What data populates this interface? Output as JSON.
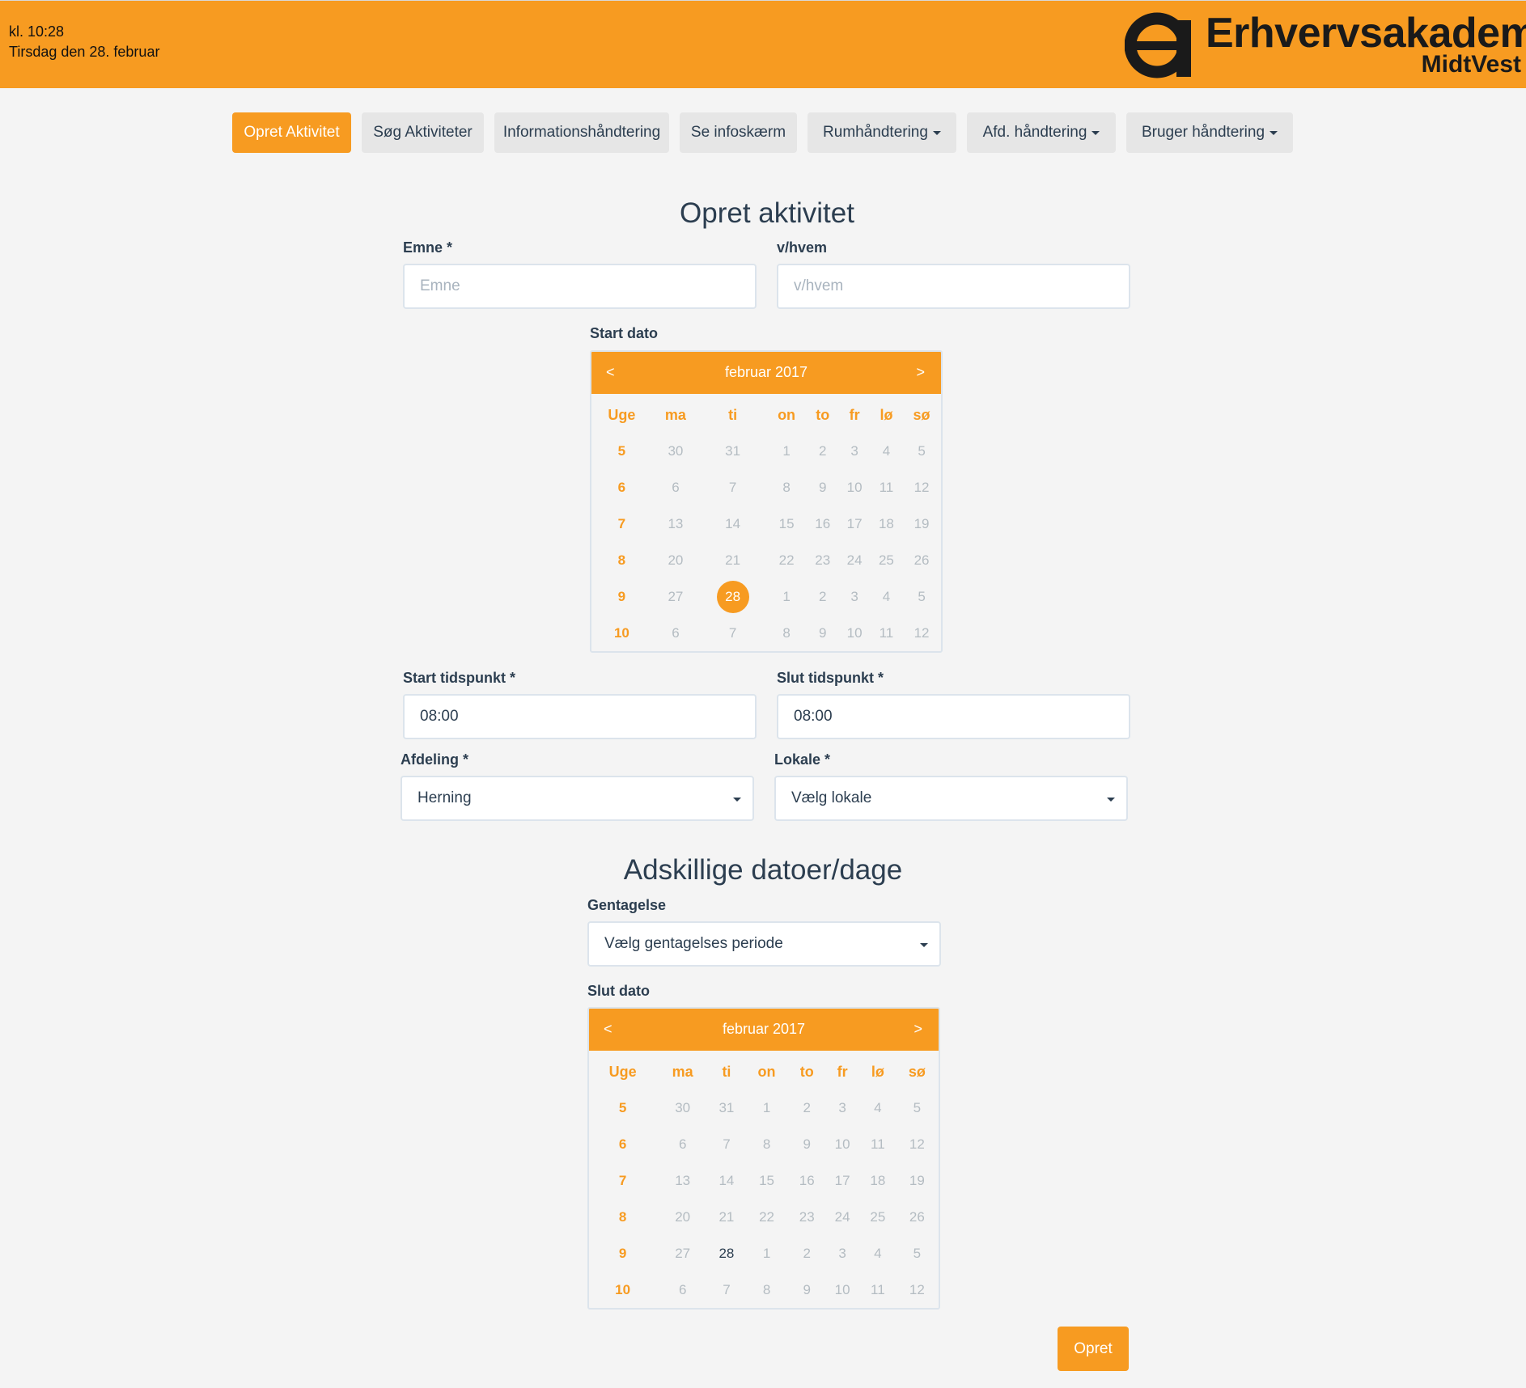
{
  "header": {
    "time": "kl. 10:28",
    "date": "Tirsdag den 28. februar",
    "logo_name": "Erhvervsakademi",
    "logo_sub": "MidtVest"
  },
  "nav": {
    "items": [
      {
        "label": "Opret Aktivitet",
        "active": true
      },
      {
        "label": "Søg Aktiviteter"
      },
      {
        "label": "Informationshåndtering"
      },
      {
        "label": "Se infoskærm"
      },
      {
        "label": "Rumhåndtering",
        "dropdown": true
      },
      {
        "label": "Afd. håndtering",
        "dropdown": true
      },
      {
        "label": "Bruger håndtering",
        "dropdown": true
      }
    ]
  },
  "form": {
    "title": "Opret aktivitet",
    "emne_label": "Emne *",
    "emne_placeholder": "Emne",
    "vhvem_label": "v/hvem",
    "vhvem_placeholder": "v/hvem",
    "start_dato_label": "Start dato",
    "start_tid_label": "Start tidspunkt *",
    "start_tid_value": "08:00",
    "slut_tid_label": "Slut tidspunkt *",
    "slut_tid_value": "08:00",
    "afdeling_label": "Afdeling *",
    "afdeling_value": "Herning",
    "lokale_label": "Lokale *",
    "lokale_value": "Vælg lokale"
  },
  "repeat": {
    "title": "Adskillige datoer/dage",
    "gentagelse_label": "Gentagelse",
    "gentagelse_value": "Vælg gentagelses periode",
    "slut_dato_label": "Slut dato"
  },
  "calendar": {
    "prev": "<",
    "next": ">",
    "month": "februar 2017",
    "headers": [
      "Uge",
      "ma",
      "ti",
      "on",
      "to",
      "fr",
      "lø",
      "sø"
    ],
    "weeks": [
      {
        "wk": "5",
        "days": [
          "30",
          "31",
          "1",
          "2",
          "3",
          "4",
          "5"
        ]
      },
      {
        "wk": "6",
        "days": [
          "6",
          "7",
          "8",
          "9",
          "10",
          "11",
          "12"
        ]
      },
      {
        "wk": "7",
        "days": [
          "13",
          "14",
          "15",
          "16",
          "17",
          "18",
          "19"
        ]
      },
      {
        "wk": "8",
        "days": [
          "20",
          "21",
          "22",
          "23",
          "24",
          "25",
          "26"
        ]
      },
      {
        "wk": "9",
        "days": [
          "27",
          "28",
          "1",
          "2",
          "3",
          "4",
          "5"
        ]
      },
      {
        "wk": "10",
        "days": [
          "6",
          "7",
          "8",
          "9",
          "10",
          "11",
          "12"
        ]
      }
    ]
  },
  "submit_label": "Opret",
  "colors": {
    "accent": "#f79b21",
    "text": "#2c3e50",
    "muted": "#b4bcc2",
    "background": "#f4f4f4"
  }
}
